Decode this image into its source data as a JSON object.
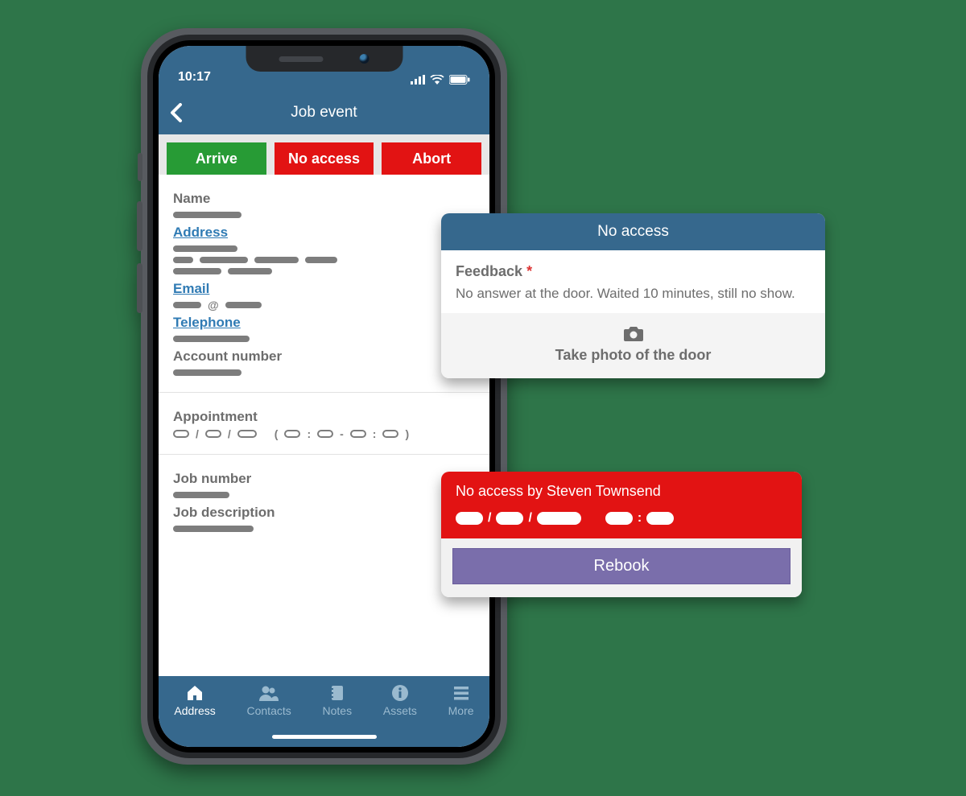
{
  "status": {
    "time": "10:17"
  },
  "header": {
    "title": "Job event"
  },
  "actions": {
    "arrive": "Arrive",
    "no_access": "No access",
    "abort": "Abort"
  },
  "fields": {
    "name": "Name",
    "address": "Address",
    "email": "Email",
    "telephone": "Telephone",
    "account_number": "Account number",
    "appointment": "Appointment",
    "job_number": "Job number",
    "job_description": "Job description"
  },
  "tabs": {
    "address": "Address",
    "contacts": "Contacts",
    "notes": "Notes",
    "assets": "Assets",
    "more": "More"
  },
  "noaccess_card": {
    "title": "No access",
    "feedback_label": "Feedback",
    "feedback_required": "*",
    "feedback_text": "No answer at the door. Waited 10 minutes, still no show.",
    "take_photo": "Take photo of the door"
  },
  "rebook_card": {
    "title": "No access by Steven Townsend",
    "rebook": "Rebook"
  },
  "colors": {
    "brand": "#36688d",
    "green": "#279b35",
    "red": "#e21313",
    "purple": "#7a6eab"
  }
}
